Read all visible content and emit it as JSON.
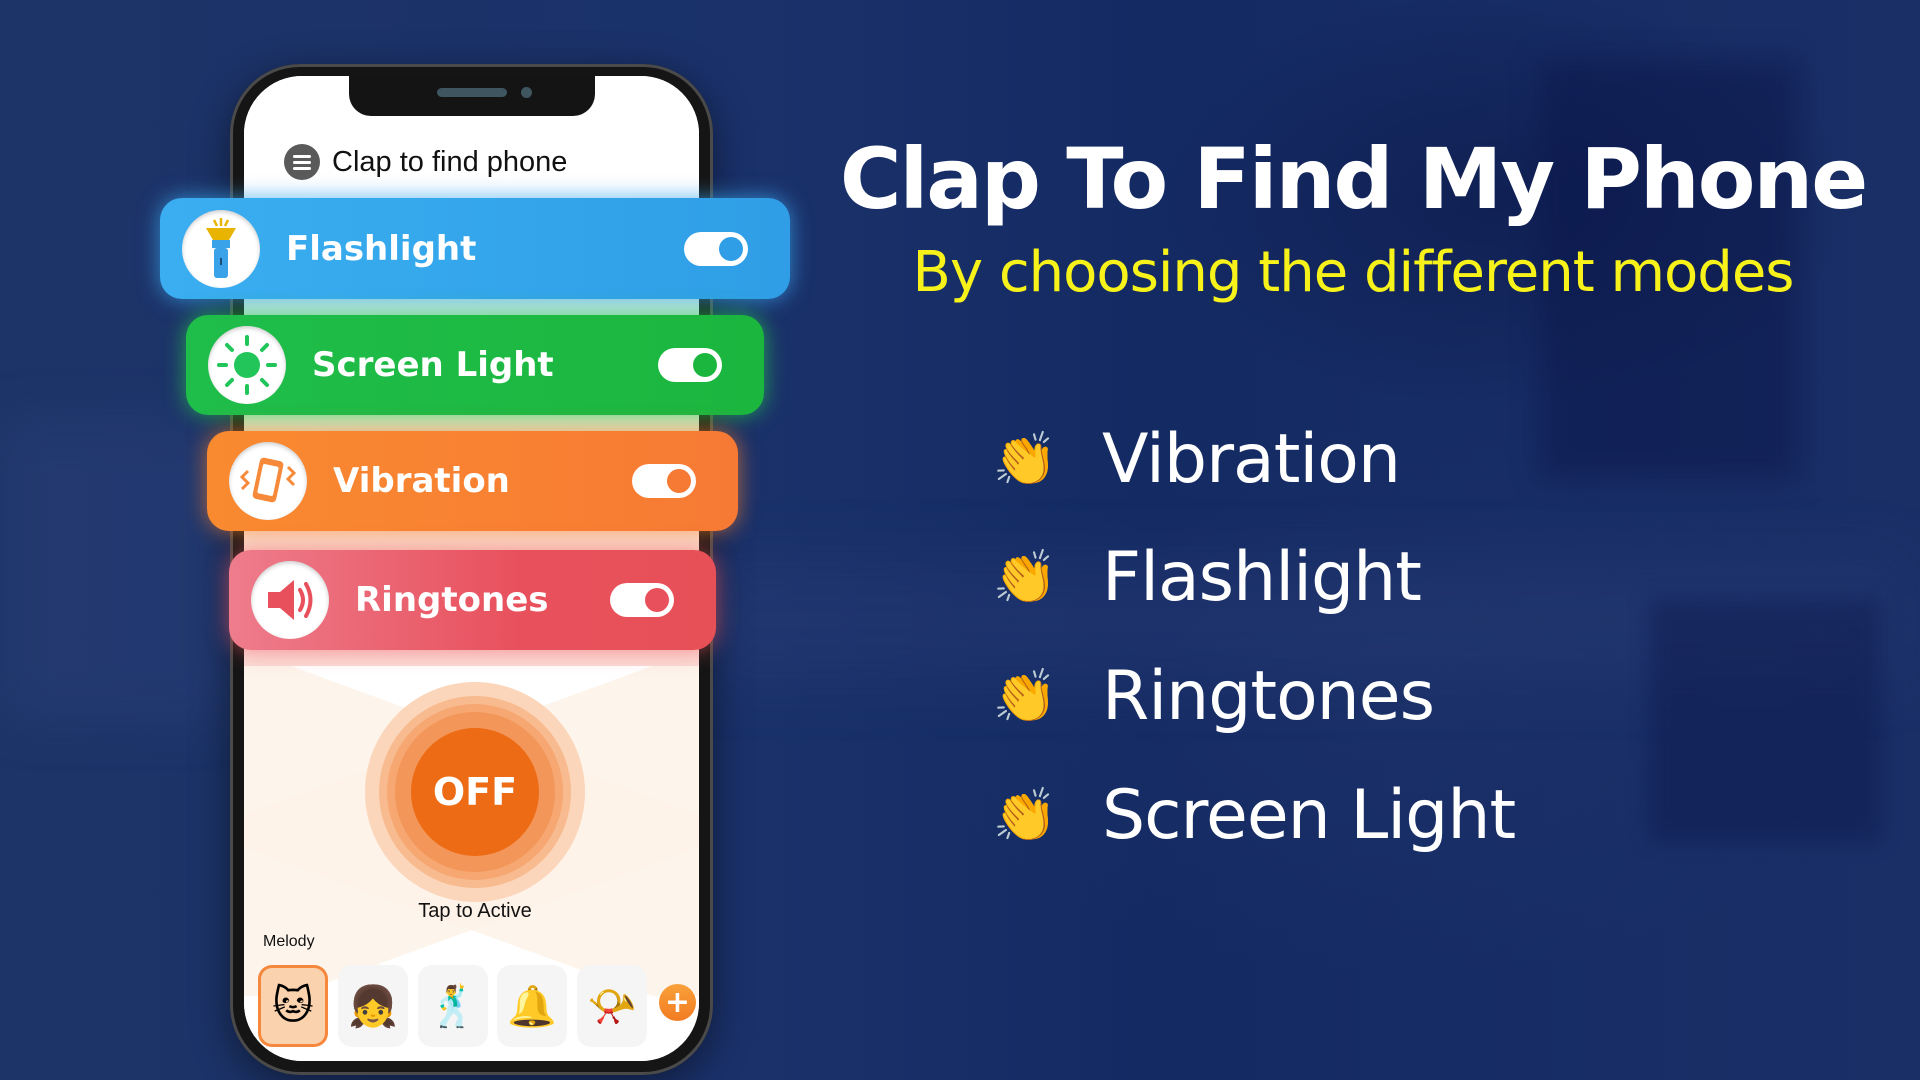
{
  "app": {
    "header_title": "Clap to find phone",
    "modes": [
      {
        "label": "Flashlight",
        "icon": "flashlight-icon",
        "enabled": true,
        "color": "#2f9ee6"
      },
      {
        "label": "Screen Light",
        "icon": "sun-icon",
        "enabled": true,
        "color": "#1bb63e"
      },
      {
        "label": "Vibration",
        "icon": "vibrating-phone-icon",
        "enabled": true,
        "color": "#f77a34"
      },
      {
        "label": "Ringtones",
        "icon": "speaker-icon",
        "enabled": true,
        "color": "#e8505c"
      }
    ],
    "power_button_label": "OFF",
    "power_hint": "Tap to Active",
    "melody_label": "Melody",
    "melodies": [
      {
        "icon": "cat-icon",
        "glyph": "🐱",
        "selected": true
      },
      {
        "icon": "girl-icon",
        "glyph": "👧",
        "selected": false
      },
      {
        "icon": "dancing-people-icon",
        "glyph": "🕺",
        "selected": false
      },
      {
        "icon": "bell-icon",
        "glyph": "🔔",
        "selected": false
      },
      {
        "icon": "whistle-icon",
        "glyph": "📯",
        "selected": false
      }
    ],
    "add_button": "+"
  },
  "promo": {
    "title": "Clap To Find My Phone",
    "subtitle": "By choosing the different modes",
    "subtitle_color": "#f7f21a",
    "features": [
      {
        "label": "Vibration",
        "icon": "clapping-hands-icon",
        "glyph": "👏"
      },
      {
        "label": "Flashlight",
        "icon": "clapping-hands-icon",
        "glyph": "👏"
      },
      {
        "label": "Ringtones",
        "icon": "clapping-hands-icon",
        "glyph": "👏"
      },
      {
        "label": "Screen Light",
        "icon": "clapping-hands-icon",
        "glyph": "👏"
      }
    ]
  }
}
